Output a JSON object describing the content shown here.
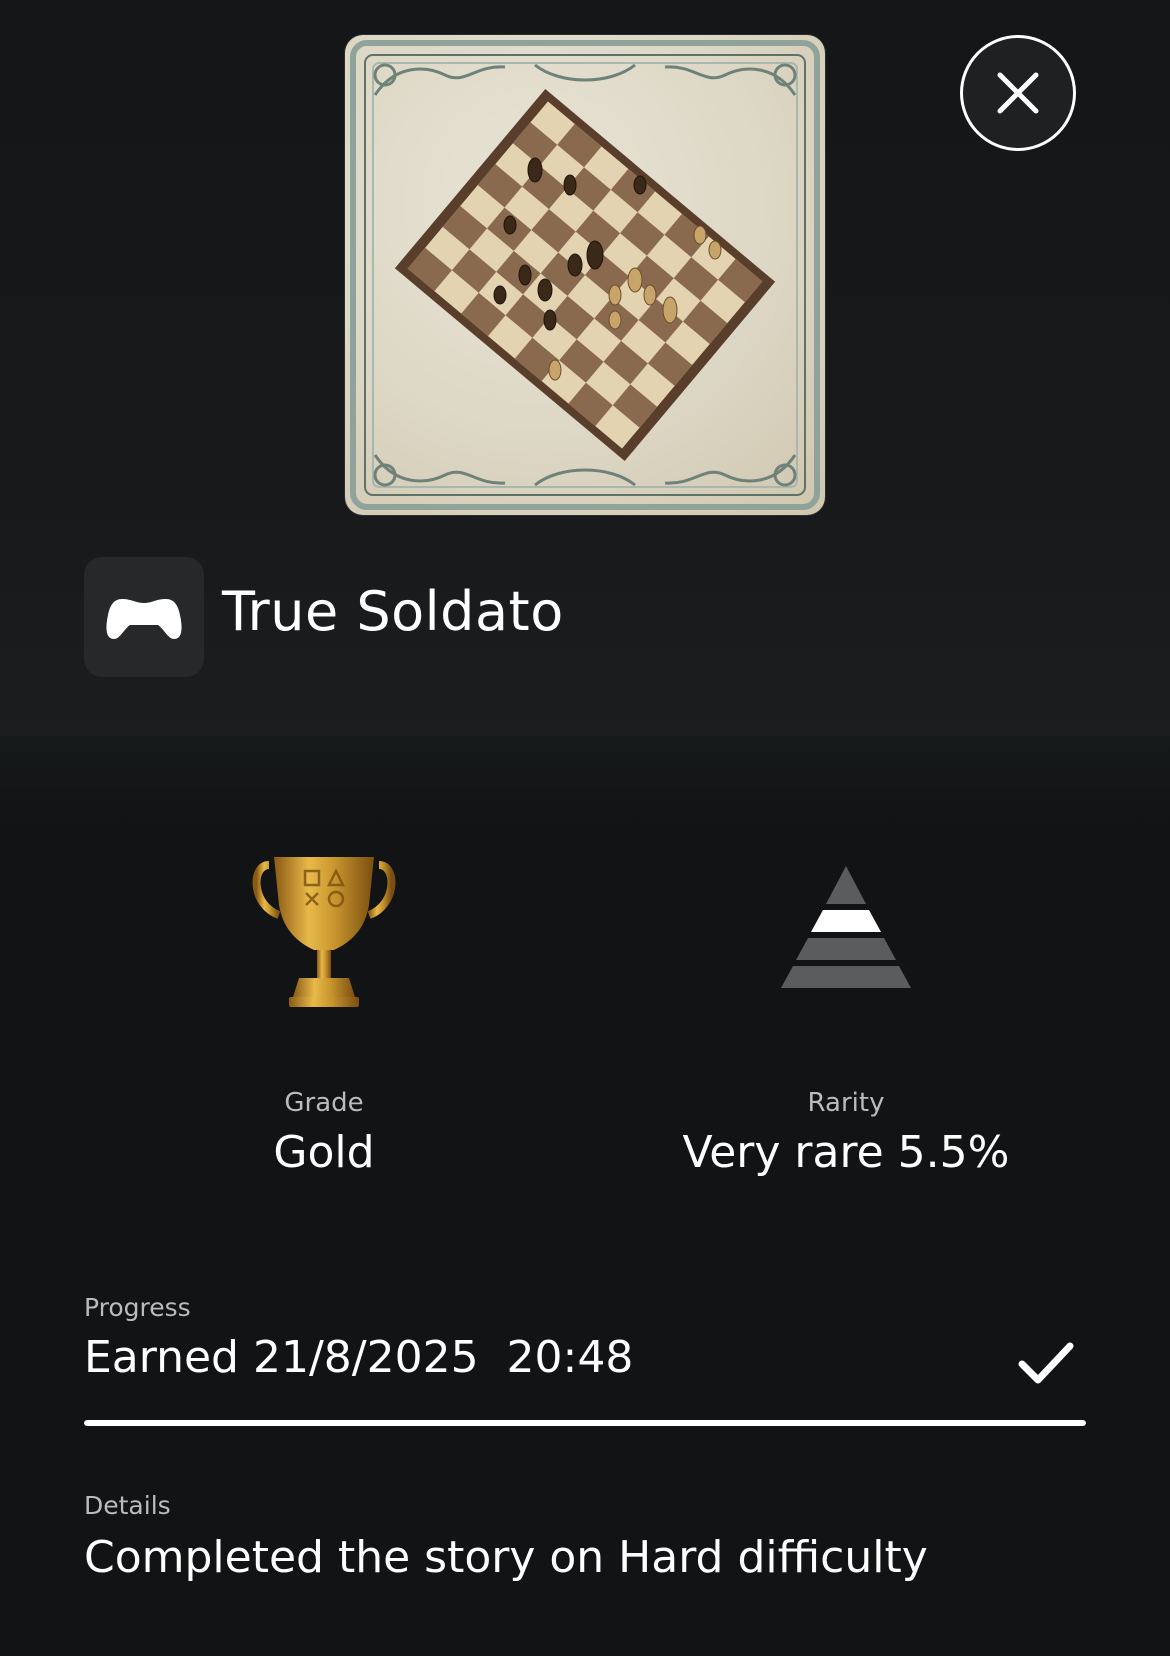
{
  "header": {
    "trophy_art": "chessboard-ornate-frame-image",
    "close_icon": "close-icon",
    "game_icon": "gamepad-icon",
    "trophy_name": "True Soldato"
  },
  "stats": {
    "grade": {
      "icon": "gold-trophy-icon",
      "label": "Grade",
      "value": "Gold",
      "color": "#c9962e"
    },
    "rarity": {
      "icon": "rarity-pyramid-icon",
      "label": "Rarity",
      "value": "Very rare 5.5%",
      "highlight_tier": 2
    }
  },
  "progress": {
    "label": "Progress",
    "value": "Earned 21/8/2025  20:48",
    "status_icon": "checkmark-icon",
    "percent": 100
  },
  "details": {
    "label": "Details",
    "value": "Completed the story on Hard difficulty"
  }
}
